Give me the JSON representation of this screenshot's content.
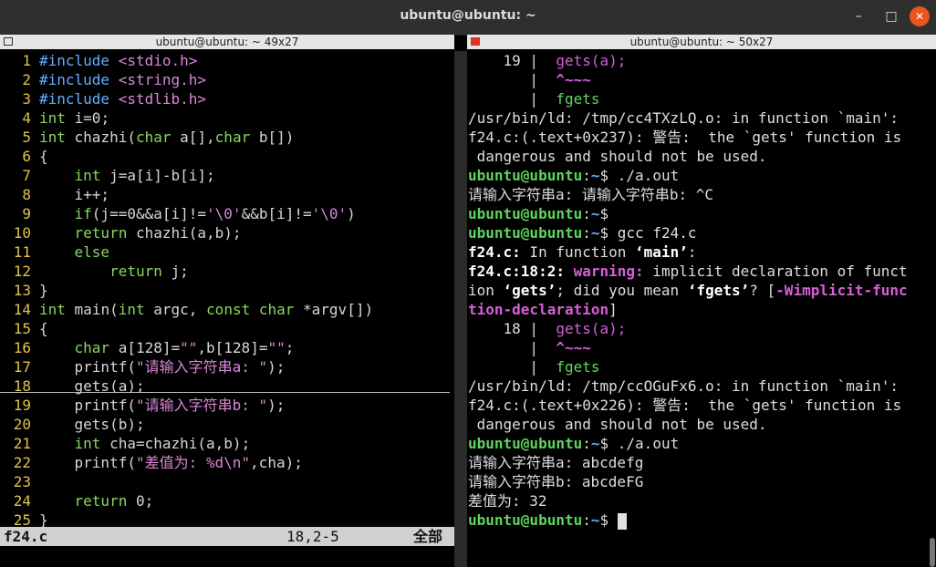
{
  "window": {
    "title": "ubuntu@ubuntu: ~"
  },
  "left_pane": {
    "title": "ubuntu@ubuntu: ~ 49x27",
    "lines": [
      {
        "n": "1",
        "t": "#include <stdio.h>"
      },
      {
        "n": "2",
        "t": "#include <string.h>"
      },
      {
        "n": "3",
        "t": "#include <stdlib.h>"
      },
      {
        "n": "4",
        "t": "int i=0;"
      },
      {
        "n": "5",
        "t": "int chazhi(char a[],char b[])"
      },
      {
        "n": "6",
        "t": "{"
      },
      {
        "n": "7",
        "t": "    int j=a[i]-b[i];"
      },
      {
        "n": "8",
        "t": "    i++;"
      },
      {
        "n": "9",
        "t": "    if(j==0&&a[i]!='\\0'&&b[i]!='\\0')"
      },
      {
        "n": "10",
        "t": "    return chazhi(a,b);"
      },
      {
        "n": "11",
        "t": "    else"
      },
      {
        "n": "12",
        "t": "        return j;"
      },
      {
        "n": "13",
        "t": "}"
      },
      {
        "n": "14",
        "t": "int main(int argc, const char *argv[])"
      },
      {
        "n": "15",
        "t": "{"
      },
      {
        "n": "16",
        "t": "    char a[128]=\"\",b[128]=\"\";"
      },
      {
        "n": "17",
        "t": "    printf(\"请输入字符串a: \");"
      },
      {
        "n": "18",
        "t": "    gets(a);"
      },
      {
        "n": "19",
        "t": "    printf(\"请输入字符串b: \");"
      },
      {
        "n": "20",
        "t": "    gets(b);"
      },
      {
        "n": "21",
        "t": "    int cha=chazhi(a,b);"
      },
      {
        "n": "22",
        "t": "    printf(\"差值为: %d\\n\",cha);"
      },
      {
        "n": "23",
        "t": ""
      },
      {
        "n": "24",
        "t": "    return 0;"
      },
      {
        "n": "25",
        "t": "}"
      }
    ],
    "status": {
      "file": "f24.c",
      "position": "18,2-5",
      "scroll": "全部"
    }
  },
  "right_pane": {
    "title": "ubuntu@ubuntu: ~ 50x27",
    "lines": [
      "    19 |  gets(a);",
      "       |  ^~~~",
      "       |  fgets",
      "/usr/bin/ld: /tmp/cc4TXzLQ.o: in function `main':",
      "f24.c:(.text+0x237): 警告:  the `gets' function is",
      " dangerous and should not be used.",
      "ubuntu@ubuntu:~$ ./a.out",
      "请输入字符串a: 请输入字符串b: ^C",
      "ubuntu@ubuntu:~$",
      "ubuntu@ubuntu:~$ gcc f24.c",
      "f24.c: In function ‘main’:",
      "f24.c:18:2: warning: implicit declaration of funct",
      "ion ‘gets’; did you mean ‘fgets’? [-Wimplicit-func",
      "tion-declaration]",
      "    18 |  gets(a);",
      "       |  ^~~~",
      "       |  fgets",
      "/usr/bin/ld: /tmp/ccOGuFx6.o: in function `main':",
      "f24.c:(.text+0x226): 警告:  the `gets' function is",
      " dangerous and should not be used.",
      "ubuntu@ubuntu:~$ ./a.out",
      "请输入字符串a: abcdefg",
      "请输入字符串b: abcdeFG",
      "差值为: 32",
      "ubuntu@ubuntu:~$ "
    ]
  },
  "colors": {
    "titlebar": "#2f2f2e",
    "close": "#e9541f",
    "linenum": "#e2c24a",
    "prompt_user": "#5ed35e",
    "prompt_path": "#6aa6ff"
  },
  "icons": [
    "terminal-icon",
    "minimize-icon",
    "maximize-icon",
    "close-icon"
  ]
}
